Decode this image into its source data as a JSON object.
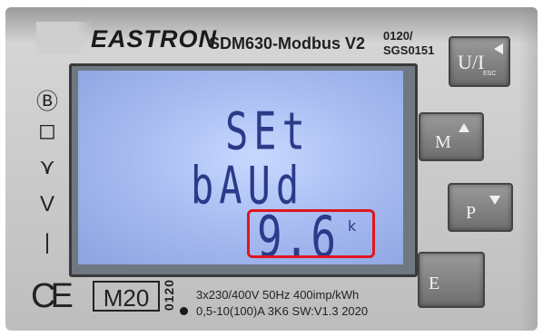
{
  "header": {
    "brand": "EASTRON",
    "model": "SDM630-Modbus V2",
    "code_line1": "0120/",
    "code_line2": "SGS0151"
  },
  "display": {
    "line1": "SEt",
    "line2": "bAUd",
    "value": "9.6",
    "unit": "k"
  },
  "buttons": {
    "ui_label": "U/I",
    "ui_sub": "ESC",
    "m_label": "M",
    "p_label": "P",
    "e_label": "E"
  },
  "symbols": {
    "b_mark": "Ⓑ",
    "square_mark": "◻",
    "wye_mark": "⋎",
    "vee_mark": "V",
    "one_mark": "|"
  },
  "footer": {
    "ce_mark": "CE",
    "class_badge": "M20",
    "year_code": "0120",
    "spec_line1": "3x230/400V  50Hz  400imp/kWh",
    "spec_line2": "0,5-10(100)A  3K6  SW:V1.3  2020"
  },
  "colors": {
    "lcd_background": "#a9bdf2",
    "lcd_segment": "#2c3a8a",
    "highlight_box": "#e0161e",
    "button_face": "#7f7f7f"
  },
  "icons": [
    "triangle-left-icon",
    "triangle-up-icon",
    "triangle-down-icon"
  ]
}
